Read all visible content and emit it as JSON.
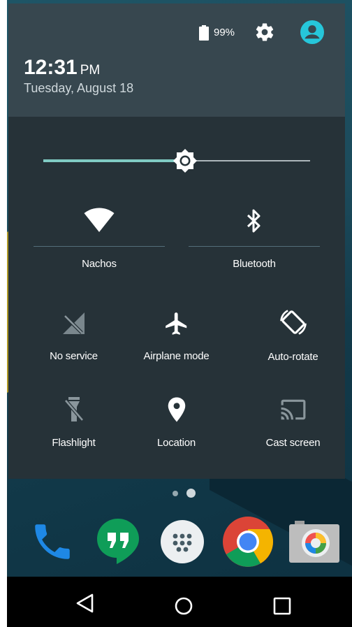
{
  "status": {
    "battery_percent": "99%",
    "time": "12:31",
    "ampm": "PM",
    "date": "Tuesday, August 18"
  },
  "brightness": {
    "level": 0.53
  },
  "tiles": {
    "wifi": {
      "label": "Nachos",
      "icon": "wifi-icon"
    },
    "bluetooth": {
      "label": "Bluetooth",
      "icon": "bluetooth-icon"
    },
    "no_service": {
      "label": "No service",
      "icon": "no-signal-icon"
    },
    "airplane": {
      "label": "Airplane mode",
      "icon": "airplane-icon"
    },
    "auto_rotate": {
      "label": "Auto-rotate",
      "icon": "rotate-icon"
    },
    "flashlight": {
      "label": "Flashlight",
      "icon": "flashlight-icon"
    },
    "location": {
      "label": "Location",
      "icon": "location-pin-icon"
    },
    "cast": {
      "label": "Cast screen",
      "icon": "cast-icon"
    }
  },
  "dock": [
    "phone-icon",
    "hangouts-icon",
    "apps-drawer-icon",
    "chrome-icon",
    "camera-icon"
  ],
  "colors": {
    "accent": "#80cbc4",
    "header_bg": "#37474f",
    "panel_bg": "#263238",
    "avatar": "#26c6da"
  }
}
